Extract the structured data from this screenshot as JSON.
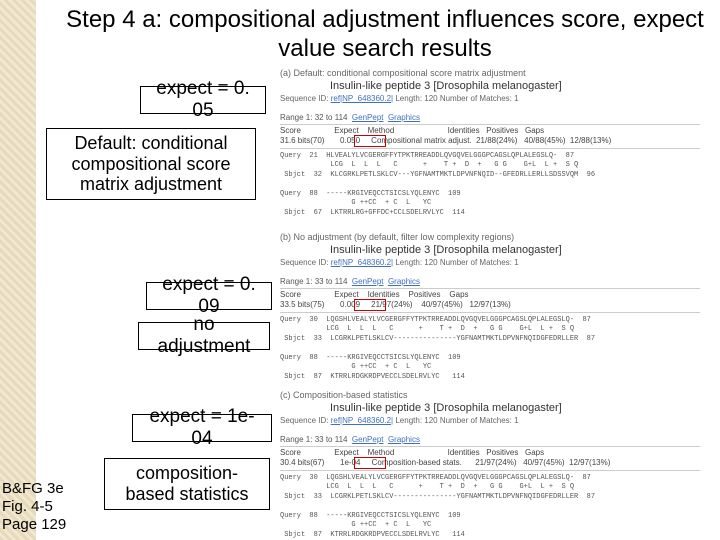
{
  "title": "Step 4 a: compositional adjustment influences score, expect value search results",
  "citation": {
    "l1": "B&FG 3e",
    "l2": "Fig. 4-5",
    "l3": "Page 129"
  },
  "boxes": {
    "expA": "expect = 0. 05",
    "descA_l1": "Default: conditional",
    "descA_l2": "compositional score",
    "descA_l3": "matrix adjustment",
    "expB": "expect = 0. 09",
    "descB": "no adjustment",
    "expC": "expect = 1e-04",
    "descC_l1": "composition-",
    "descC_l2": "based statistics"
  },
  "panels": {
    "a": {
      "caption": "(a) Default: conditional compositional score matrix adjustment",
      "seq_title": "Insulin-like peptide 3 [Drosophila melanogaster]",
      "seq_sub": "Sequence ID: ref|NP_648360.2| Length: 120  Number of Matches: 1",
      "range": "Range 1: 32 to 114  GenPept  Graphics",
      "headers": "Score               Expect    Method                        Identities   Positives   Gaps",
      "values": "31.6 bits(70)       0.050     Compositional matrix adjust.  21/88(24%)   40/88(45%)  12/88(13%)",
      "aln": "Query  21  HLVEALYLVCGERGFFYTPKTRREADDLQVGQVELGGGPCAGSLQPLALEGSLQ-  87\n            LCG  L  L  L   C      +    T +  D  +   G G    G+L  L +  S Q\n Sbjct  32  KLCGRKLPETLSKLCV---YGFNAMTMKTLDPVNFNQID--GFEDRLLERLLSDSSVQM  96\n\nQuery  88  -----KRGIVEQCCTSICSLYQLENYC  109\n                 G ++CC  + C  L   YC\n Sbjct  67  LKTRRLRG+GFFDC+CCLSDELRVLYC  114"
    },
    "b": {
      "caption": "(b) No adjustment (by default, filter low complexity regions)",
      "seq_title": "Insulin-like peptide 3 [Drosophila melanogaster]",
      "seq_sub": "Sequence ID: ref|NP_648360.2| Length: 120  Number of Matches: 1",
      "range": "Range 1: 33 to 114  GenPept  Graphics",
      "headers": "Score               Expect    Identities    Positives    Gaps",
      "values": "33.5 bits(75)       0.009     21/97(24%)    40/97(45%)   12/97(13%)",
      "aln": "Query  30  LQGSHLVEALYLVCGERGFFYTPKTRREADDLQVGQVELGGGPCAGSLQPLALEGSLQ-  87\n           LCG  L  L  L   C      +    T +  D  +   G G    G+L  L +  S Q\n Sbjct  33  LCGRKLPETLSKLCV---------------YGFNAMTMKTLDPVNFNQIDGFEDRLLER  87\n\nQuery  88  -----KRGIVEQCCTSICSLYQLENYC  109\n                 G ++CC  + C  L   YC\n Sbjct  87  KTRRLRDGKRDPVECCLSDELRVLYC   114"
    },
    "c": {
      "caption": "(c) Composition-based statistics",
      "seq_title": "Insulin-like peptide 3 [Drosophila melanogaster]",
      "seq_sub": "Sequence ID: ref|NP_648360.2| Length: 120  Number of Matches: 1",
      "range": "Range 1: 33 to 114  GenPept  Graphics",
      "headers": "Score               Expect    Method                        Identities   Positives   Gaps",
      "values": "30.4 bits(67)       1e-04     Composition-based stats.      21/97(24%)   40/97(45%)  12/97(13%)",
      "aln": "Query  30  LQGSHLVEALYLVCGERGFFYTPKTRREADDLQVGQVELGGGPCAGSLQPLALEGSLQ-  87\n           LCG  L  L  L   C      +    T +  D  +   G G    G+L  L +  S Q\n Sbjct  33  LCGRKLPETLSKLCV---------------YGFNAMTMKTLDPVNFNQIDGFEDRLLER  87\n\nQuery  88  -----KRGIVEQCCTSICSLYQLENYC  109\n                 G ++CC  + C  L   YC\n Sbjct  87  KTRRLRDGKRDPVECCLSDELRVLYC   114"
    }
  }
}
